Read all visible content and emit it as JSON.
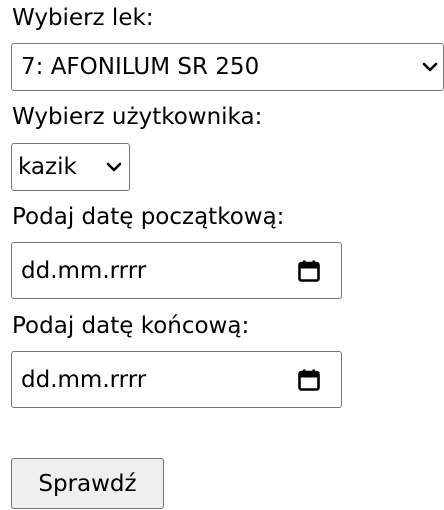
{
  "form": {
    "drug_label": "Wybierz lek:",
    "drug_selected": "7: AFONILUM SR 250",
    "user_label": "Wybierz użytkownika:",
    "user_selected": "kazik",
    "start_date_label": "Podaj datę początkową:",
    "start_date_placeholder": "dd.mm.rrrr",
    "end_date_label": "Podaj datę końcową:",
    "end_date_placeholder": "dd.mm.rrrr",
    "submit_label": "Sprawdź"
  },
  "icons": {
    "dropdown": "chevron-down-icon",
    "date_picker": "calendar-icon"
  },
  "colors": {
    "border": "#767676",
    "button_background": "#efefef",
    "text": "#000000"
  }
}
